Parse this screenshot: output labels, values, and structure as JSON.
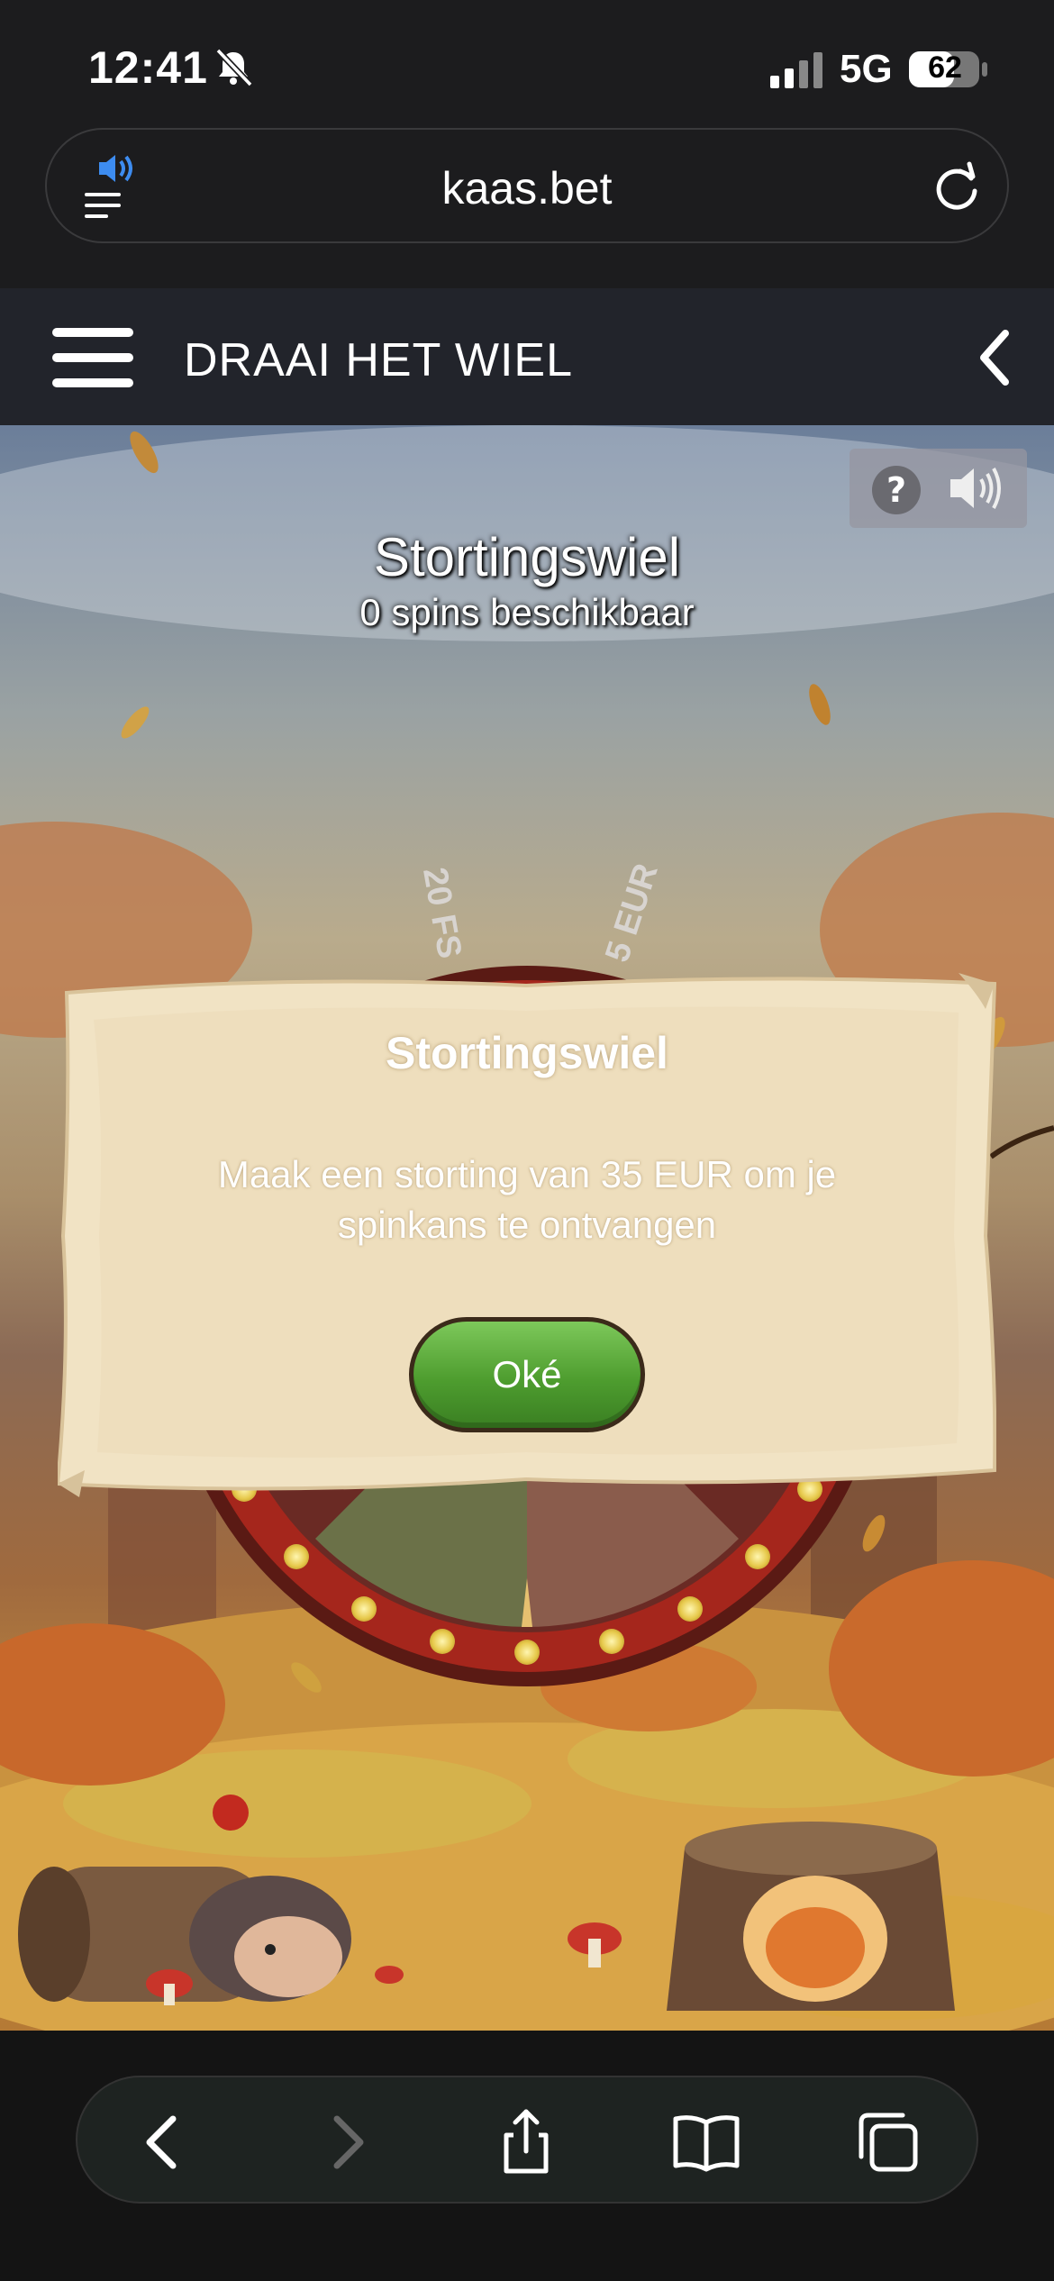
{
  "status_bar": {
    "time": "12:41",
    "network": "5G",
    "battery": "62"
  },
  "browser": {
    "url": "kaas.bet"
  },
  "header": {
    "title": "DRAAI HET WIEL"
  },
  "wheel": {
    "title": "Stortingswiel",
    "spins_text": "0 spins beschikbaar",
    "segment_labels": [
      "20 FS",
      "5 EUR"
    ]
  },
  "modal": {
    "title": "Stortingswiel",
    "message": "Maak een storting van 35 EUR om je spinkans te ontvangen",
    "ok_label": "Oké"
  },
  "colors": {
    "ok_button": "#4e9d2f",
    "header_bg": "#22242b",
    "wheel_rim": "#a5261c",
    "parchment": "#efe0bf"
  },
  "icons": {
    "status": [
      "bell-slash-icon",
      "signal-icon",
      "battery-icon"
    ],
    "browser": [
      "audio-playing-icon",
      "reload-icon"
    ],
    "header": [
      "menu-icon",
      "back-chevron-icon"
    ],
    "game": [
      "help-icon",
      "sound-icon"
    ],
    "toolbar": [
      "back-icon",
      "forward-icon",
      "share-icon",
      "bookmarks-icon",
      "tabs-icon"
    ]
  }
}
